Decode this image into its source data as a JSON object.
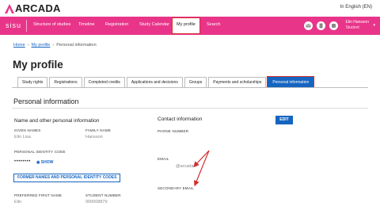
{
  "brand": {
    "logo_text": "ARCADA"
  },
  "topbar": {
    "language": "In English (EN)"
  },
  "nav": {
    "app_name": "sisu",
    "items": [
      {
        "label": "Structure of studies"
      },
      {
        "label": "Timeline"
      },
      {
        "label": "Registration"
      },
      {
        "label": "Study Calendar"
      },
      {
        "label": "My profile"
      },
      {
        "label": "Search"
      }
    ],
    "user": {
      "name": "Elin Hansson",
      "role": "Student"
    }
  },
  "breadcrumb": {
    "home": "Home",
    "profile": "My profile",
    "current": "Personal information"
  },
  "page": {
    "title": "My profile"
  },
  "tabs": [
    {
      "label": "Study rights"
    },
    {
      "label": "Registrations"
    },
    {
      "label": "Completed credits"
    },
    {
      "label": "Applications and decisions"
    },
    {
      "label": "Groups"
    },
    {
      "label": "Payments and scholarships"
    },
    {
      "label": "Personal information"
    }
  ],
  "personal": {
    "section_title": "Personal information",
    "names_title": "Name and other personal information",
    "given_names_label": "GIVEN NAMES",
    "given_names": "Elin Lisa",
    "family_name_label": "FAMILY NAME",
    "family_name": "Hansson",
    "pid_label": "PERSONAL IDENTITY CODE",
    "pid_masked": "••••••••",
    "show_label": "SHOW",
    "former_button": "FORMER NAMES AND PERSONAL IDENTITY CODES",
    "preferred_label": "PREFERRED FIRST NAME",
    "preferred": "Elin",
    "student_no_label": "STUDENT NUMBER",
    "student_no": "000008879"
  },
  "contact": {
    "title": "Contact information",
    "edit_button": "EDIT",
    "phone_label": "PHONE NUMBER",
    "email_label": "EMAIL",
    "email_value": "@arcada.fi",
    "secondary_email_label": "SECONDARY EMAIL"
  },
  "colors": {
    "brand_pink": "#e8358a",
    "link_blue": "#1565c0",
    "highlight_red": "#d32f2f"
  }
}
